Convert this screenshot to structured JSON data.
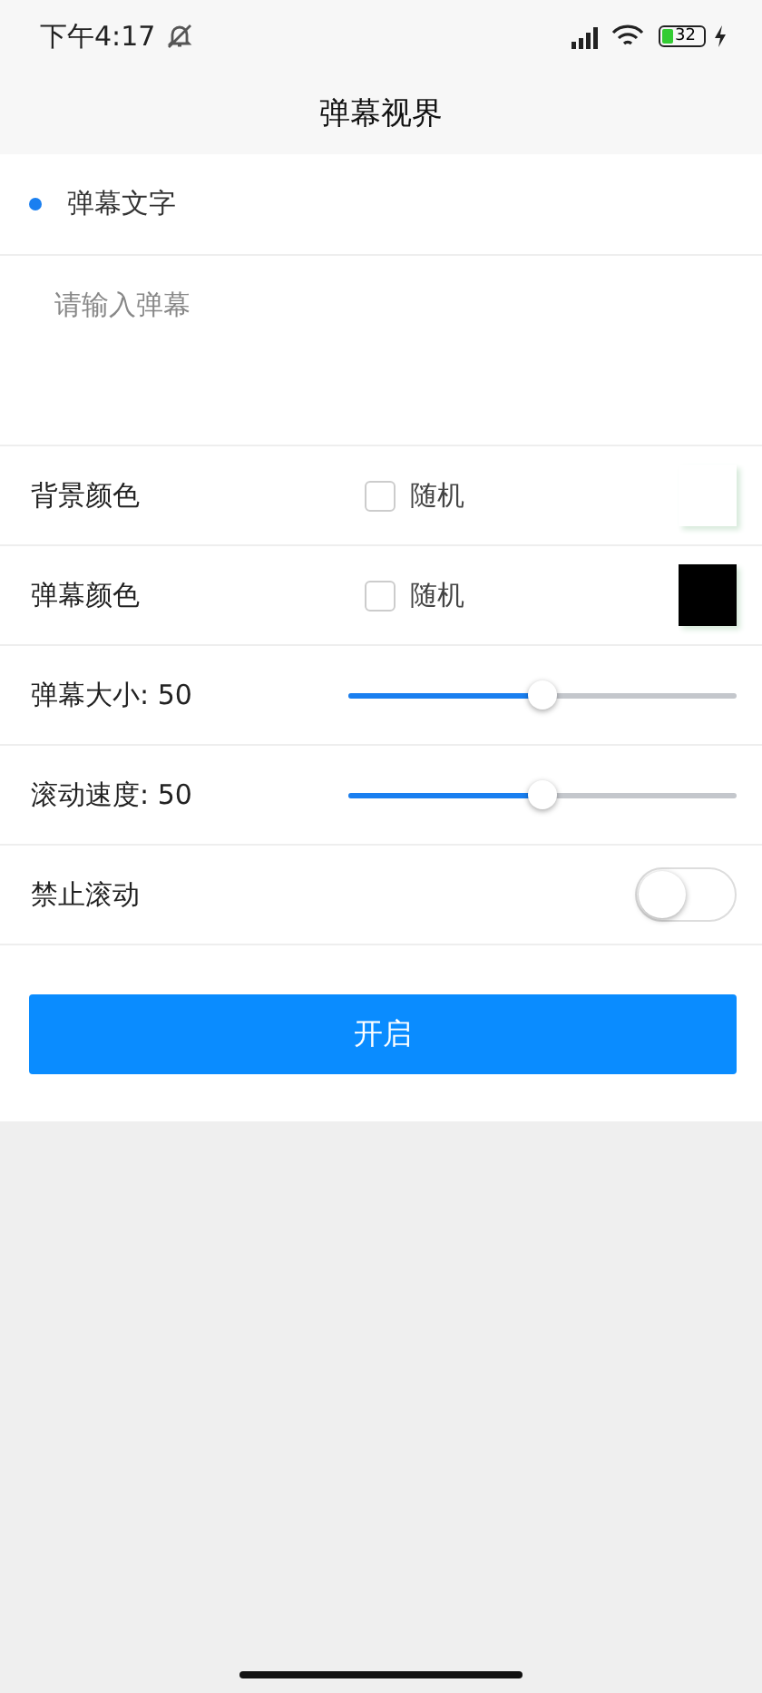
{
  "status_bar": {
    "time": "下午4:17",
    "battery": "32"
  },
  "title": "弹幕视界",
  "section": {
    "label": "弹幕文字"
  },
  "input": {
    "placeholder": "请输入弹幕"
  },
  "rows": [
    {
      "kind": "color",
      "label": "背景颜色",
      "random_label": "随机",
      "checked": false,
      "color": "#ffffff"
    },
    {
      "kind": "color",
      "label": "弹幕颜色",
      "random_label": "随机",
      "checked": false,
      "color": "#000000"
    },
    {
      "kind": "slider",
      "label": "弹幕大小: 50",
      "level": 0.5
    },
    {
      "kind": "slider",
      "label": "滚动速度: 50",
      "level": 0.5
    },
    {
      "kind": "switch",
      "label": "禁止滚动",
      "on": false
    }
  ],
  "button": "开启"
}
